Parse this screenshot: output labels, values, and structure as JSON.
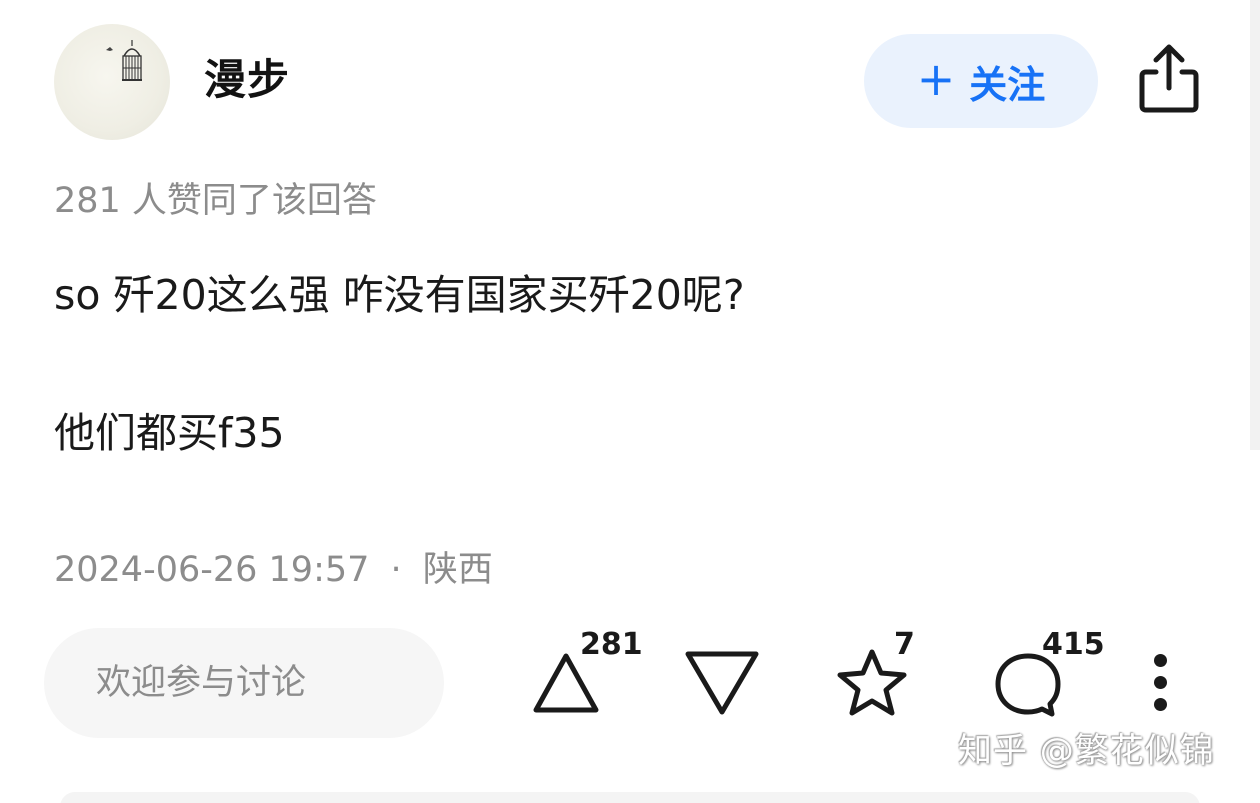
{
  "author": {
    "name": "漫步",
    "avatar_icon": "birdcage-icon"
  },
  "follow_button": {
    "plus_icon": "+",
    "label": "关注"
  },
  "share_icon": "share-icon",
  "agree_text": "281 人赞同了该回答",
  "content": {
    "line1": "so 歼20这么强 咋没有国家买歼20呢?",
    "line2": "他们都买f35"
  },
  "meta": {
    "datetime": "2024-06-26 19:57",
    "separator": "·",
    "location": "陕西"
  },
  "comment_input": {
    "placeholder": "欢迎参与讨论"
  },
  "actions": {
    "upvote_count": "281",
    "favorite_count": "7",
    "comment_count": "415"
  },
  "watermark": "知乎 @繁花似锦",
  "colors": {
    "accent": "#1772f6",
    "follow_bg": "#eaf2fd",
    "muted": "#8c8c8c"
  }
}
